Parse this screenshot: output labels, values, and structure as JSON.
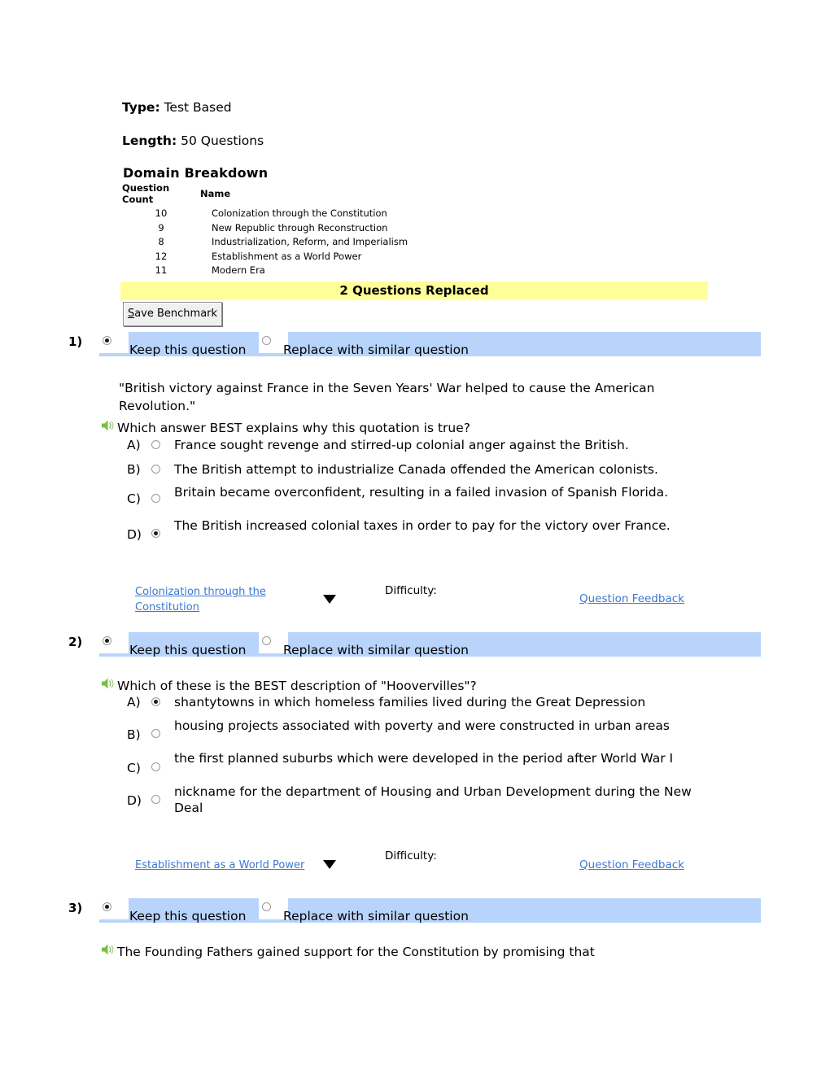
{
  "header": {
    "type_label": "Type:",
    "type_value": "Test Based",
    "length_label": "Length:",
    "length_value": "50 Questions",
    "domain_breakdown_title": "Domain Breakdown"
  },
  "domain_table": {
    "headers": [
      "Question Count",
      "Name"
    ],
    "rows": [
      {
        "count": "10",
        "name": "Colonization through the Constitution"
      },
      {
        "count": "9",
        "name": "New Republic through Reconstruction"
      },
      {
        "count": "8",
        "name": "Industrialization, Reform, and Imperialism"
      },
      {
        "count": "12",
        "name": "Establishment as a World Power"
      },
      {
        "count": "11",
        "name": "Modern Era"
      }
    ]
  },
  "banner": {
    "text": "2 Questions Replaced",
    "background": "#ffff99"
  },
  "toolbar": {
    "save_accel": "S",
    "save_rest": "ave Benchmark"
  },
  "common": {
    "keep_label": "Keep this question",
    "replace_label": "Replace with similar question",
    "difficulty_label": "Difficulty:",
    "feedback_label": "Question Feedback",
    "band_color": "#b8d4fb",
    "link_color": "#3b78cf",
    "speaker_color": "#77c043"
  },
  "questions": [
    {
      "number": "1)",
      "keep_selected": true,
      "replace_selected": false,
      "quote": "\"British victory against France in the Seven Years' War helped to cause the American Revolution.\"",
      "stem": "Which answer BEST explains why this quotation is true?",
      "options": [
        {
          "letter": "A)",
          "text": "France sought revenge and stirred-up colonial anger against the British.",
          "selected": false
        },
        {
          "letter": "B)",
          "text": "The British attempt to industrialize Canada offended the American colonists.",
          "selected": false
        },
        {
          "letter": "C)",
          "text": "Britain became overconfident, resulting in a failed invasion of Spanish Florida.",
          "selected": false
        },
        {
          "letter": "D)",
          "text": "The British increased colonial taxes in order to pay for the victory over France.",
          "selected": true
        }
      ],
      "domain_link": "Colonization through the Constitution"
    },
    {
      "number": "2)",
      "keep_selected": true,
      "replace_selected": false,
      "quote": "",
      "stem": "Which of these is the BEST description of \"Hoovervilles\"?",
      "options": [
        {
          "letter": "A)",
          "text": "shantytowns in which homeless families lived during the Great Depression",
          "selected": true
        },
        {
          "letter": "B)",
          "text": "housing projects associated with poverty and were constructed in urban areas",
          "selected": false
        },
        {
          "letter": "C)",
          "text": "the first planned suburbs which were developed in the period after World War I",
          "selected": false
        },
        {
          "letter": "D)",
          "text": "nickname for the department of Housing and Urban Development during the New Deal",
          "selected": false
        }
      ],
      "domain_link": "Establishment as a World Power"
    },
    {
      "number": "3)",
      "keep_selected": true,
      "replace_selected": false,
      "quote": "",
      "stem": "The Founding Fathers gained support for the Constitution by promising that",
      "options": [],
      "domain_link": ""
    }
  ]
}
